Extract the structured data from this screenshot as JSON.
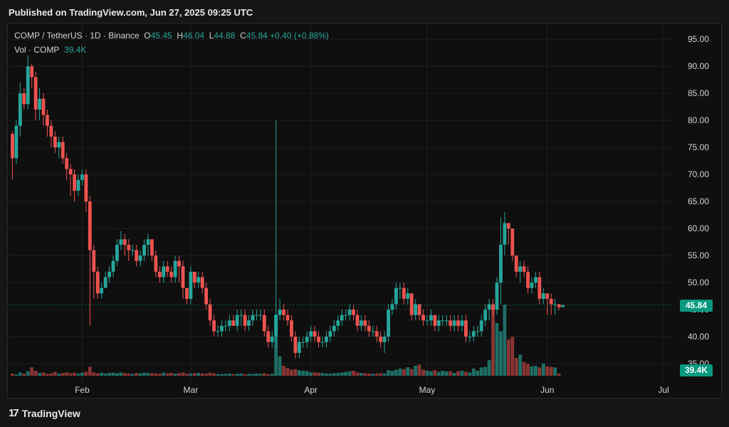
{
  "header": {
    "published": "Published on TradingView.com, Jun 27, 2025 09:25 UTC"
  },
  "footer": {
    "logo_mark": "17",
    "logo_text": "TradingView"
  },
  "legend": {
    "symbol": "COMP / TetherUS · 1D · Binance",
    "o_label": "O",
    "o_value": "45.45",
    "h_label": "H",
    "h_value": "46.04",
    "l_label": "L",
    "l_value": "44.88",
    "c_label": "C",
    "c_value": "45.84",
    "change": "+0.40 (+0.88%)",
    "vol_label": "Vol · COMP",
    "vol_value": "39.4K"
  },
  "price_tag": "45.84",
  "volume_tag": "39.4K",
  "colors": {
    "up": "#26a69a",
    "down": "#ef5350",
    "vol_up": "#1f6e66",
    "vol_down": "#8a3434",
    "accent": "#089981"
  },
  "chart_data": {
    "type": "candlestick",
    "title": "COMP / TetherUS · 1D · Binance",
    "x_tick_labels": [
      "Feb",
      "Mar",
      "Apr",
      "May",
      "Jun",
      "Jul"
    ],
    "x_ticks_day": [
      19,
      47,
      78,
      108,
      139,
      169
    ],
    "y_tick_labels": [
      "35.00",
      "40.00",
      "45.00",
      "50.00",
      "55.00",
      "60.00",
      "65.00",
      "70.00",
      "75.00",
      "80.00",
      "85.00",
      "90.00",
      "95.00"
    ],
    "y_ticks": [
      35,
      40,
      45,
      50,
      55,
      60,
      65,
      70,
      75,
      80,
      85,
      90,
      95
    ],
    "ylim": [
      32.5,
      97
    ],
    "xlim": [
      0,
      171
    ],
    "grid": true,
    "last_price": 45.84,
    "days": [
      1,
      2,
      3,
      4,
      5,
      6,
      7,
      8,
      9,
      10,
      11,
      12,
      13,
      14,
      15,
      16,
      17,
      18,
      19,
      20,
      21,
      22,
      23,
      24,
      25,
      26,
      27,
      28,
      29,
      30,
      31,
      32,
      33,
      34,
      35,
      36,
      37,
      38,
      39,
      40,
      41,
      42,
      43,
      44,
      45,
      46,
      47,
      48,
      49,
      50,
      51,
      52,
      53,
      54,
      55,
      56,
      57,
      58,
      59,
      60,
      61,
      62,
      63,
      64,
      65,
      66,
      67,
      68,
      69,
      70,
      71,
      72,
      73,
      74,
      75,
      76,
      77,
      78,
      79,
      80,
      81,
      82,
      83,
      84,
      85,
      86,
      87,
      88,
      89,
      90,
      91,
      92,
      93,
      94,
      95,
      96,
      97,
      98,
      99,
      100,
      101,
      102,
      103,
      104,
      105,
      106,
      107,
      108,
      109,
      110,
      111,
      112,
      113,
      114,
      115,
      116,
      117,
      118,
      119,
      120,
      121,
      122,
      123,
      124,
      125,
      126,
      127,
      128,
      129,
      130,
      131,
      132,
      133,
      134,
      135,
      136,
      137,
      138,
      139,
      140,
      141,
      142,
      143,
      144,
      145,
      146,
      147,
      148,
      149,
      150,
      151,
      152,
      153,
      154,
      155,
      156,
      157,
      158,
      159,
      160,
      161,
      162,
      163,
      164,
      165
    ],
    "open": [
      77.5,
      73,
      79,
      85,
      83,
      90,
      88,
      82,
      84,
      81,
      79,
      77,
      75,
      76,
      73,
      71,
      70,
      67,
      69,
      70,
      65,
      56,
      52,
      48,
      49,
      51,
      52,
      54,
      57,
      58,
      57,
      56,
      56,
      54,
      55,
      57,
      58,
      55,
      52,
      51,
      53,
      52,
      51,
      54,
      53,
      49,
      47,
      52,
      50,
      51,
      49,
      46,
      43,
      41,
      41,
      42,
      42,
      43,
      42,
      44,
      44,
      42,
      43,
      44,
      44,
      44,
      41,
      39,
      40,
      44,
      45,
      44,
      43,
      40,
      37,
      39,
      39,
      40,
      41,
      40,
      39,
      39,
      40,
      41,
      42,
      43,
      44,
      44,
      45,
      44,
      42,
      43,
      42,
      41,
      41,
      40,
      39,
      40,
      45,
      46,
      49,
      49,
      47,
      48,
      44,
      46,
      44,
      43,
      43,
      44,
      42,
      43,
      43,
      43,
      42,
      43,
      42,
      43,
      40,
      40,
      41,
      41,
      43,
      45,
      46,
      45,
      50,
      57,
      61,
      60,
      55,
      52,
      53,
      52,
      49,
      50,
      51,
      47,
      48,
      47,
      46,
      46,
      45.45
    ],
    "close": [
      73,
      79,
      85,
      83,
      90,
      88,
      82,
      84,
      81,
      79,
      77,
      75,
      76,
      73,
      71,
      70,
      67,
      69,
      70,
      65,
      56,
      52,
      48,
      49,
      51,
      52,
      54,
      57,
      58,
      57,
      56,
      56,
      54,
      55,
      57,
      58,
      55,
      52,
      51,
      53,
      52,
      51,
      54,
      53,
      49,
      47,
      52,
      50,
      51,
      49,
      46,
      43,
      41,
      41,
      42,
      42,
      43,
      42,
      44,
      44,
      42,
      43,
      44,
      44,
      44,
      41,
      39,
      40,
      44,
      45,
      44,
      43,
      40,
      37,
      39,
      39,
      40,
      41,
      40,
      39,
      39,
      40,
      41,
      42,
      43,
      44,
      44,
      45,
      44,
      42,
      43,
      42,
      41,
      41,
      40,
      39,
      40,
      45,
      46,
      49,
      49,
      47,
      48,
      44,
      46,
      44,
      43,
      43,
      44,
      42,
      43,
      43,
      43,
      42,
      43,
      42,
      43,
      40,
      40,
      41,
      41,
      43,
      45,
      46,
      45,
      50,
      57,
      61,
      60,
      55,
      52,
      53,
      52,
      49,
      50,
      51,
      47,
      48,
      47,
      46,
      46,
      45.45,
      45.84
    ],
    "high": [
      78,
      80,
      87,
      86,
      92,
      90.5,
      89,
      86,
      85,
      82,
      80,
      78,
      77,
      77,
      74,
      72,
      71,
      70,
      71,
      71,
      66,
      57,
      53,
      50,
      52,
      53,
      55,
      58,
      59.5,
      59,
      58,
      57,
      57,
      56,
      58,
      59,
      58,
      56,
      53,
      54,
      54,
      53,
      55,
      55,
      54,
      49,
      53,
      52,
      52,
      52,
      50,
      47,
      44,
      42,
      43,
      43,
      44,
      44,
      45,
      45,
      45,
      44,
      45,
      45,
      45,
      45,
      42,
      41,
      80,
      47,
      46,
      45,
      44,
      41,
      40,
      40,
      41,
      42,
      42,
      41,
      40,
      41,
      42,
      43,
      44,
      45,
      45,
      46,
      46,
      45,
      44,
      44,
      43,
      42,
      42,
      41,
      41,
      46,
      47,
      50,
      50,
      50,
      49,
      48,
      47,
      46,
      45,
      44,
      45,
      44,
      44,
      44,
      44,
      44,
      44,
      44,
      44,
      44,
      41,
      42,
      42,
      44,
      46,
      47,
      47,
      51,
      62,
      63,
      61,
      57,
      54,
      54,
      54,
      53,
      51,
      52,
      52,
      49,
      48,
      48,
      47,
      46.04
    ],
    "low": [
      69,
      72,
      77,
      82,
      82,
      86,
      80,
      80,
      79,
      77,
      75,
      74,
      73,
      72,
      69,
      66,
      65,
      66,
      68,
      63,
      42,
      47,
      47,
      47,
      49,
      50,
      51,
      53,
      56,
      55,
      54,
      55,
      53,
      53,
      54,
      55,
      54,
      51,
      50,
      50,
      51,
      50,
      50,
      50,
      47,
      46,
      46,
      49,
      49,
      48,
      45,
      42,
      40,
      40,
      40,
      41,
      41,
      42,
      41,
      42,
      41,
      41,
      42,
      43,
      43,
      40,
      38,
      38,
      38,
      43,
      43,
      42,
      39,
      36,
      36,
      38,
      38,
      39,
      39,
      38,
      38,
      38,
      39,
      40,
      41,
      42,
      43,
      43,
      43,
      41,
      41,
      41,
      40,
      40,
      39,
      38,
      37,
      39,
      44,
      45,
      47,
      46,
      46,
      43,
      43,
      43,
      42,
      42,
      42,
      41,
      41,
      42,
      42,
      41,
      41,
      41,
      41,
      39,
      39,
      39,
      40,
      40,
      42,
      43,
      44,
      44,
      46,
      55,
      57,
      54,
      51,
      50,
      51,
      48,
      48,
      49,
      46,
      46,
      44,
      44,
      44,
      44.88
    ],
    "volume_k": [
      40,
      25,
      60,
      35,
      80,
      150,
      90,
      50,
      60,
      35,
      45,
      70,
      40,
      50,
      60,
      45,
      55,
      40,
      55,
      70,
      160,
      60,
      45,
      55,
      40,
      50,
      55,
      45,
      60,
      50,
      40,
      35,
      50,
      45,
      55,
      50,
      45,
      40,
      35,
      55,
      45,
      50,
      40,
      45,
      60,
      35,
      40,
      45,
      50,
      40,
      35,
      55,
      45,
      30,
      30,
      35,
      40,
      30,
      35,
      40,
      30,
      35,
      30,
      40,
      35,
      45,
      30,
      35,
      1100,
      350,
      180,
      140,
      110,
      120,
      100,
      90,
      85,
      60,
      60,
      55,
      50,
      40,
      40,
      45,
      50,
      60,
      70,
      80,
      90,
      60,
      50,
      45,
      40,
      35,
      40,
      45,
      40,
      100,
      90,
      110,
      130,
      120,
      150,
      120,
      180,
      200,
      110,
      90,
      80,
      100,
      70,
      90,
      80,
      80,
      50,
      80,
      90,
      70,
      60,
      130,
      90,
      150,
      160,
      280,
      1200,
      950,
      800,
      1280,
      650,
      700,
      320,
      380,
      250,
      210,
      170,
      180,
      150,
      220,
      170,
      160,
      150,
      39.4
    ]
  }
}
